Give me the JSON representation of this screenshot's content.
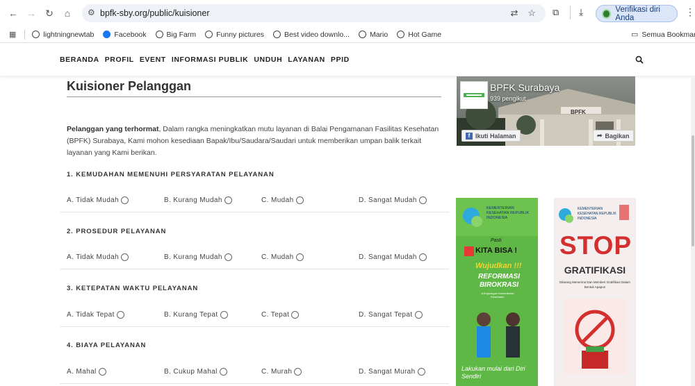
{
  "browser": {
    "url": "bpfk-sby.org/public/kuisioner",
    "verify_label": "Verifikasi diri Anda",
    "bookmarks": [
      "lightningnewtab",
      "Facebook",
      "Big Farm",
      "Funny pictures",
      "Best video downlo...",
      "Mario",
      "Hot Game"
    ],
    "all_bookmarks": "Semua Bookmark"
  },
  "nav": {
    "items": [
      "BERANDA",
      "PROFIL",
      "EVENT",
      "INFORMASI PUBLIK",
      "UNDUH",
      "LAYANAN",
      "PPID"
    ]
  },
  "page": {
    "title": "Kuisioner Pelanggan",
    "intro_bold": "Pelanggan yang terhormat",
    "intro_rest": ", Dalam rangka meningkatkan mutu layanan di Balai Pengamanan Fasilitas Kesehatan (BPFK) Surabaya, Kami mohon kesediaan Bapak/Ibu/Saudara/Saudari untuk memberikan umpan balik terkait layanan yang Kami berikan."
  },
  "questions": [
    {
      "title": "1. KEMUDAHAN MEMENUHI PERSYARATAN PELAYANAN",
      "options": [
        "A. Tidak Mudah",
        "B. Kurang Mudah",
        "C. Mudah",
        "D. Sangat Mudah"
      ]
    },
    {
      "title": "2. PROSEDUR PELAYANAN",
      "options": [
        "A. Tidak Mudah",
        "B. Kurang Mudah",
        "C. Mudah",
        "D. Sangat Mudah"
      ]
    },
    {
      "title": "3. KETEPATAN WAKTU PELAYANAN",
      "options": [
        "A. Tidak Tepat",
        "B. Kurang Tepat",
        "C. Tepat",
        "D. Sangat Tepat"
      ]
    },
    {
      "title": "4. BIAYA PELAYANAN",
      "options": [
        "A. Mahal",
        "B. Cukup Mahal",
        "C. Murah",
        "D. Sangat Murah"
      ]
    }
  ],
  "facebook": {
    "page_name": "BPFK Surabaya",
    "followers": "939 pengikut",
    "follow_label": "Ikuti Halaman",
    "share_label": "Bagikan",
    "building_sign": "BPFK"
  },
  "banners": {
    "left": {
      "ministry": "KEMENTERIAN KESEHATAN REPUBLIK INDONESIA",
      "line1": "Pasti",
      "line2": "KITA BISA !",
      "line3": "Wujudkan !!!",
      "line4": "REFORMASI BIROKRASI",
      "line5": "di lingkungan Kementerian Kesehatan",
      "line6": "Lakukan mulai dari Diri Sendiri"
    },
    "right": {
      "ministry": "KEMENTERIAN KESEHATAN REPUBLIK INDONESIA",
      "headline": "STOP",
      "subhead": "GRATIFIKASI",
      "tagline": "Dilarang Menerima Dan Memberi Gratifikasi Dalam Bentuk Apapun"
    }
  },
  "colors": {
    "accent": "#1a73e8",
    "banner_green": "#4caf50",
    "stop_red": "#d32f2f",
    "fb_blue": "#4267b2"
  }
}
